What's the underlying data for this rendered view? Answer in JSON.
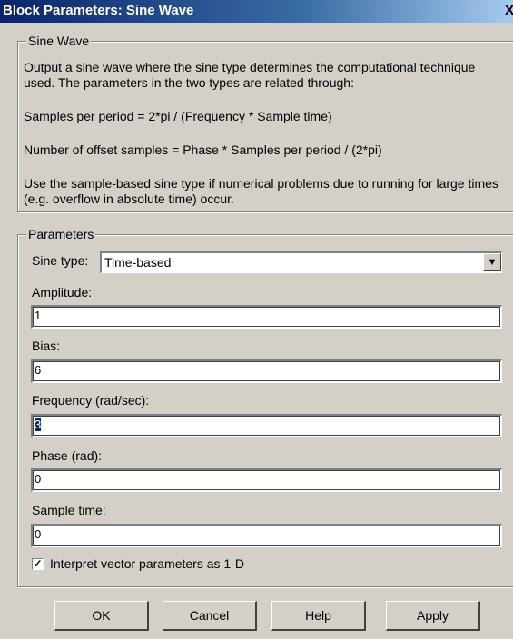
{
  "window": {
    "title": "Block Parameters: Sine Wave",
    "close_glyph": "X"
  },
  "description": {
    "group_title": "Sine Wave",
    "p1": "Output a sine wave where the sine type determines the computational technique used. The parameters in the two types are related through:",
    "p2": "Samples per period = 2*pi / (Frequency * Sample time)",
    "p3": "Number of offset samples = Phase * Samples per period / (2*pi)",
    "p4": "Use the sample-based sine type if numerical problems due to running for large times (e.g. overflow in absolute time) occur."
  },
  "parameters": {
    "group_title": "Parameters",
    "sine_type_label": "Sine type:",
    "sine_type_value": "Time-based",
    "amplitude_label": "Amplitude:",
    "amplitude_value": "1",
    "bias_label": "Bias:",
    "bias_value": "6",
    "frequency_label": "Frequency (rad/sec):",
    "frequency_value": "3",
    "phase_label": "Phase (rad):",
    "phase_value": "0",
    "sample_time_label": "Sample time:",
    "sample_time_value": "0",
    "interpret_checked": true,
    "interpret_label": "Interpret vector parameters as 1-D"
  },
  "buttons": {
    "ok": "OK",
    "cancel": "Cancel",
    "help": "Help",
    "apply": "Apply"
  }
}
